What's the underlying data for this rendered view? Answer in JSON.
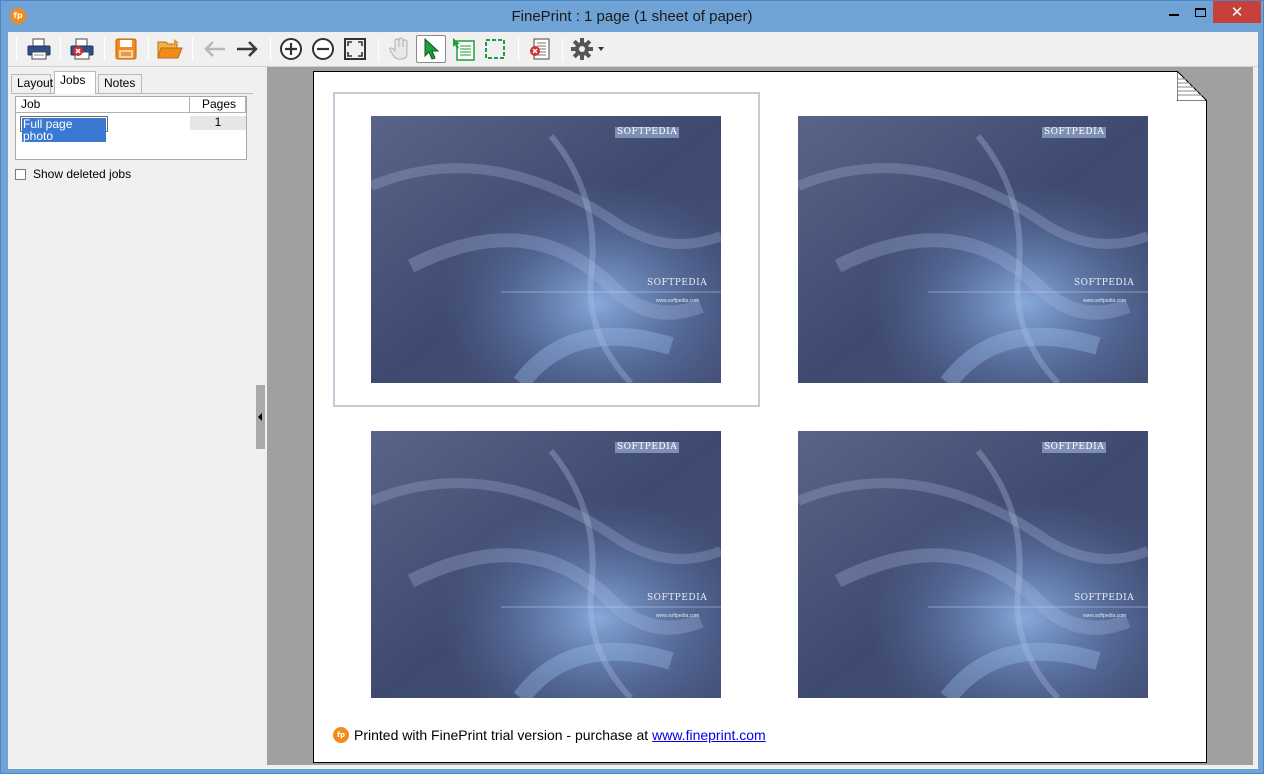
{
  "window": {
    "title": "FinePrint : 1 page (1 sheet of paper)",
    "app_icon": "fp",
    "minimize_icon": "minimize-icon",
    "maximize_icon": "maximize-icon",
    "close_glyph": "✕"
  },
  "toolbar": {
    "buttons": [
      {
        "name": "print",
        "icon": "printer-icon"
      },
      {
        "name": "print-delete",
        "icon": "printer-delete-icon"
      },
      {
        "name": "save",
        "icon": "save-icon"
      },
      {
        "name": "open",
        "icon": "folder-open-icon"
      },
      {
        "name": "back",
        "icon": "arrow-left-icon",
        "enabled": false
      },
      {
        "name": "forward",
        "icon": "arrow-right-icon"
      },
      {
        "name": "zoom-in",
        "icon": "zoom-in-icon"
      },
      {
        "name": "zoom-out",
        "icon": "zoom-out-icon"
      },
      {
        "name": "fit",
        "icon": "fit-page-icon"
      },
      {
        "name": "pan",
        "icon": "hand-icon",
        "enabled": false
      },
      {
        "name": "select",
        "icon": "cursor-icon",
        "active": true
      },
      {
        "name": "select-page",
        "icon": "page-select-icon"
      },
      {
        "name": "select-area",
        "icon": "area-select-icon"
      },
      {
        "name": "delete-page",
        "icon": "delete-page-icon"
      },
      {
        "name": "settings",
        "icon": "gear-icon"
      }
    ]
  },
  "tabs": [
    {
      "label": "Layout",
      "selected": false
    },
    {
      "label": "Jobs",
      "selected": true
    },
    {
      "label": "Notes",
      "selected": false
    }
  ],
  "jobs": {
    "columns": {
      "job": "Job",
      "pages": "Pages"
    },
    "rows": [
      {
        "name": "Full page photo",
        "pages": "1"
      }
    ],
    "show_deleted_label": "Show deleted jobs",
    "show_deleted_checked": false
  },
  "preview": {
    "photos": [
      {
        "watermark": "SOFTPEDIA",
        "brand": "SOFTPEDIA",
        "url": "www.softpedia.com"
      },
      {
        "watermark": "SOFTPEDIA",
        "brand": "SOFTPEDIA",
        "url": "www.softpedia.com"
      },
      {
        "watermark": "SOFTPEDIA",
        "brand": "SOFTPEDIA",
        "url": "www.softpedia.com"
      },
      {
        "watermark": "SOFTPEDIA",
        "brand": "SOFTPEDIA",
        "url": "www.softpedia.com"
      }
    ],
    "footer": {
      "text": "Printed with FinePrint trial version - purchase at",
      "link": "www.fineprint.com",
      "icon": "fp"
    }
  },
  "colors": {
    "frame": "#6fa3d6",
    "accent_orange": "#f28b1c",
    "close_red": "#c7403a",
    "photo_base": "#4a5577"
  }
}
